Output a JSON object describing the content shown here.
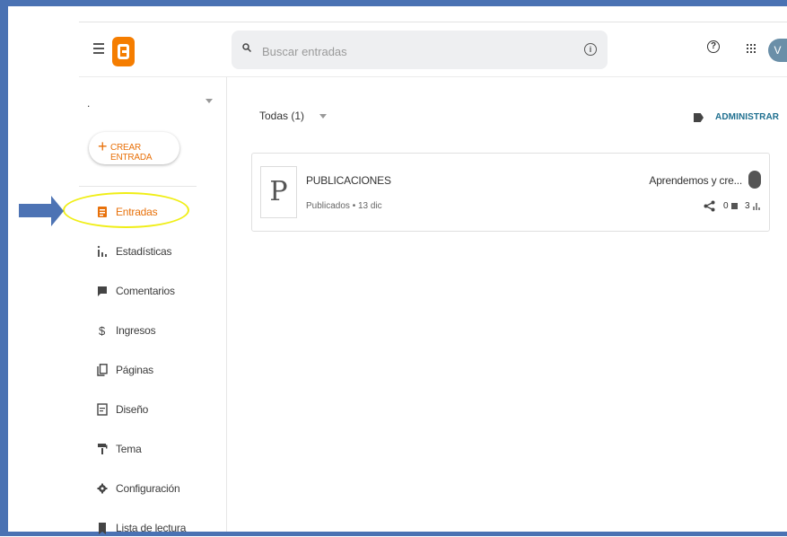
{
  "colors": {
    "accent": "#e8710a",
    "brand": "#f57d00",
    "link": "#1e6f8f",
    "annotation_arrow": "#4d73b4",
    "annotation_highlight": "#f0ee16"
  },
  "header": {
    "search_placeholder": "Buscar entradas",
    "avatar_letter": "V",
    "icons": [
      "menu-icon",
      "blogger-logo",
      "search-icon",
      "info-icon",
      "help-icon",
      "apps-icon"
    ]
  },
  "sidebar": {
    "blog_name": ".",
    "create_button": {
      "plus": "+",
      "label": "CREAR ENTRADA"
    },
    "items": [
      {
        "label": "Entradas",
        "icon": "posts-icon",
        "active": true
      },
      {
        "label": "Estadísticas",
        "icon": "stats-icon",
        "active": false
      },
      {
        "label": "Comentarios",
        "icon": "comments-icon",
        "active": false
      },
      {
        "label": "Ingresos",
        "icon": "dollar-icon",
        "active": false
      },
      {
        "label": "Páginas",
        "icon": "pages-icon",
        "active": false
      },
      {
        "label": "Diseño",
        "icon": "layout-icon",
        "active": false
      },
      {
        "label": "Tema",
        "icon": "paint-roller-icon",
        "active": false
      },
      {
        "label": "Configuración",
        "icon": "gear-icon",
        "active": false
      },
      {
        "label": "Lista de lectura",
        "icon": "bookmark-icon",
        "active": false
      }
    ]
  },
  "main": {
    "filter_label": "Todas (1)",
    "manage_label": "ADMINISTRAR",
    "posts": [
      {
        "thumbnail_letter": "P",
        "title": "PUBLICACIONES",
        "meta": "Publicados • 13 dic",
        "author": "Aprendemos y cre...",
        "comments": "0",
        "views": "3"
      }
    ]
  },
  "help_glyph": "?",
  "info_glyph": "i"
}
